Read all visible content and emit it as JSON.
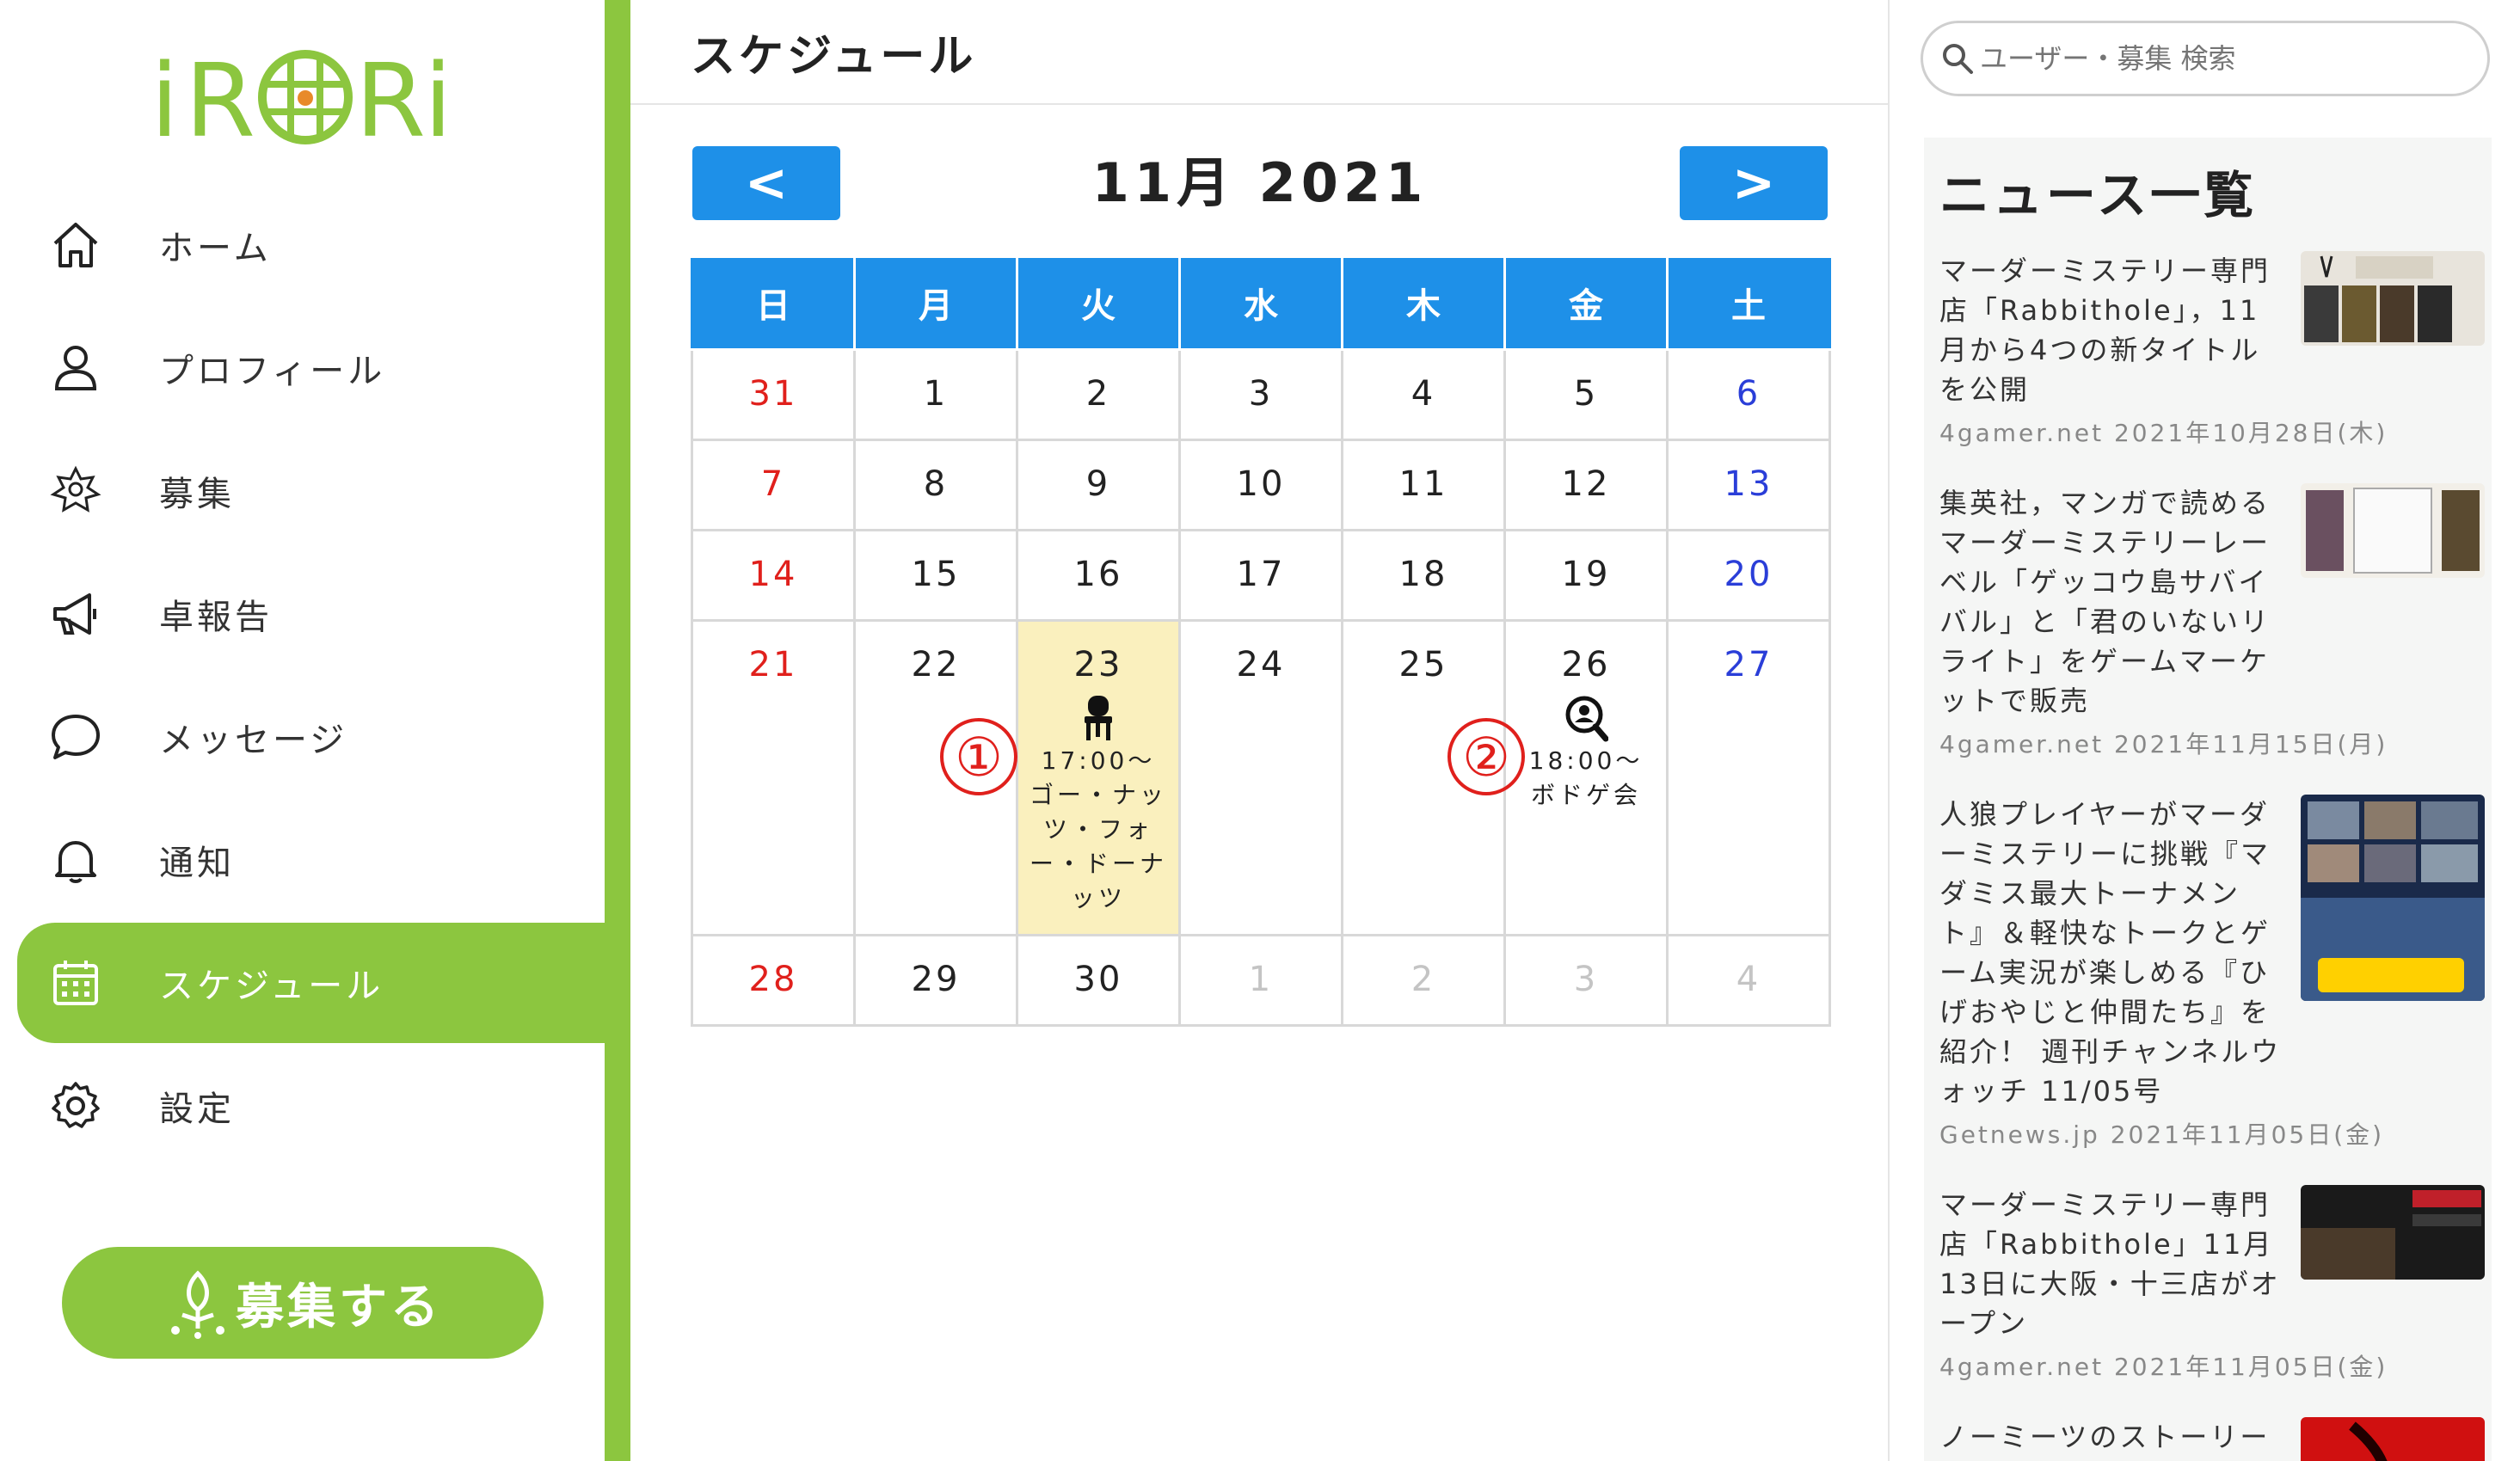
{
  "app": {
    "logo_text": "iRORi",
    "accent_color": "#8cc63f",
    "primary_color": "#1e90e8"
  },
  "sidebar": {
    "items": [
      {
        "label": "ホーム",
        "icon": "home-icon"
      },
      {
        "label": "プロフィール",
        "icon": "user-icon"
      },
      {
        "label": "募集",
        "icon": "recruit-icon"
      },
      {
        "label": "卓報告",
        "icon": "megaphone-icon"
      },
      {
        "label": "メッセージ",
        "icon": "chat-icon"
      },
      {
        "label": "通知",
        "icon": "bell-icon"
      },
      {
        "label": "スケジュール",
        "icon": "calendar-icon",
        "active": true
      },
      {
        "label": "設定",
        "icon": "gear-icon"
      }
    ],
    "recruit_button": "募集する"
  },
  "main": {
    "title": "スケジュール",
    "month_label": "11月 2021",
    "prev_label": "<",
    "next_label": ">",
    "weekdays": [
      "日",
      "月",
      "火",
      "水",
      "木",
      "金",
      "土"
    ],
    "weeks": [
      [
        {
          "d": "31",
          "other": true
        },
        {
          "d": "1"
        },
        {
          "d": "2"
        },
        {
          "d": "3"
        },
        {
          "d": "4"
        },
        {
          "d": "5"
        },
        {
          "d": "6"
        }
      ],
      [
        {
          "d": "7"
        },
        {
          "d": "8"
        },
        {
          "d": "9"
        },
        {
          "d": "10"
        },
        {
          "d": "11"
        },
        {
          "d": "12"
        },
        {
          "d": "13"
        }
      ],
      [
        {
          "d": "14"
        },
        {
          "d": "15"
        },
        {
          "d": "16"
        },
        {
          "d": "17"
        },
        {
          "d": "18"
        },
        {
          "d": "19"
        },
        {
          "d": "20"
        }
      ],
      [
        {
          "d": "21"
        },
        {
          "d": "22"
        },
        {
          "d": "23",
          "highlight": true,
          "event": {
            "icon": "chair-icon",
            "time": "17:00～",
            "title": "ゴー・ナッツ・フォー・ドーナッツ"
          }
        },
        {
          "d": "24"
        },
        {
          "d": "25"
        },
        {
          "d": "26",
          "event": {
            "icon": "search-user-icon",
            "time": "18:00～",
            "title": "ボドゲ会"
          }
        },
        {
          "d": "27"
        }
      ],
      [
        {
          "d": "28"
        },
        {
          "d": "29"
        },
        {
          "d": "30"
        },
        {
          "d": "1",
          "other": true
        },
        {
          "d": "2",
          "other": true
        },
        {
          "d": "3",
          "other": true
        },
        {
          "d": "4",
          "other": true
        }
      ]
    ],
    "markers": [
      "①",
      "②"
    ]
  },
  "right": {
    "search_placeholder": "ユーザー・募集 検索",
    "news_title": "ニュース一覧",
    "news": [
      {
        "text": "マーダーミステリー専門店「Rabbithole」，11月から4つの新タイトルを公開",
        "meta": "4gamer.net 2021年10月28日(木)"
      },
      {
        "text": "集英社，マンガで読めるマーダーミステリーレーベル「ゲッコウ島サバイバル」と「君のいないリライト」をゲームマーケットで販売",
        "meta": "4gamer.net 2021年11月15日(月)"
      },
      {
        "text": "人狼プレイヤーがマーダーミステリーに挑戦『マダミス最大トーナメント』＆軽快なトークとゲーム実況が楽しめる『ひげおやじと仲間たち』を紹介！ 週刊チャンネルウォッチ 11/05号",
        "meta": "Getnews.jp 2021年11月05日(金)"
      },
      {
        "text": "マーダーミステリー専門店「Rabbithole」11月13日に大阪・十三店がオープン",
        "meta": "4gamer.net 2021年11月05日(金)"
      },
      {
        "text": "ノーミーツのストーリー",
        "meta": ""
      }
    ]
  }
}
